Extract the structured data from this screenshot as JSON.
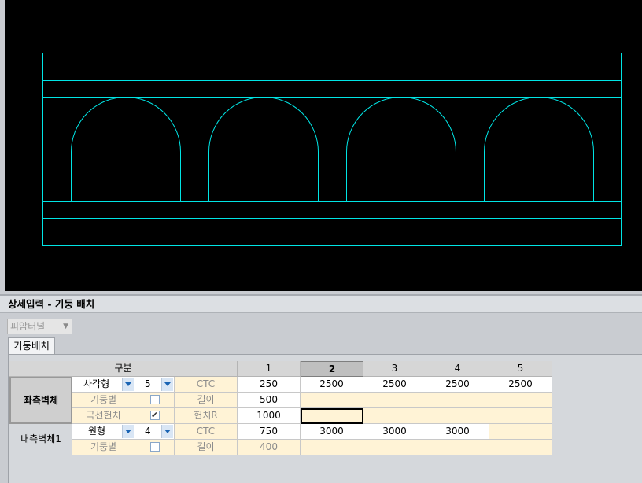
{
  "panel": {
    "title": "상세입력 - 기둥 배치",
    "pattern_select_placeholder": "피암터널",
    "tab_label": "기둥배치"
  },
  "colors": {
    "viewport_bg": "#000000",
    "drawing_line": "#00e5e5",
    "header_selected": "#bfbfbf",
    "yellow_cell": "#fff3d6"
  },
  "grid": {
    "header_label": "구분",
    "column_headers": [
      "1",
      "2",
      "3",
      "4",
      "5"
    ],
    "selected_column": "2",
    "left_wall": {
      "label": "좌측벽체",
      "shape_value": "사각형",
      "count_value": "5",
      "per_column_label": "기둥별",
      "per_column_checked": false,
      "curve_label": "곡선헌치",
      "curve_checked": true,
      "ctc_label": "CTC",
      "length_label": "길이",
      "haunch_label": "헌치R",
      "ctc_values": [
        "250",
        "2500",
        "2500",
        "2500",
        "2500"
      ],
      "length_values": [
        "500",
        "",
        "",
        "",
        ""
      ],
      "haunch_values": [
        "1000",
        "",
        "",
        "",
        ""
      ]
    },
    "inner_wall": {
      "label": "내측벽체1",
      "shape_value": "원형",
      "count_value": "4",
      "per_column_label": "기둥별",
      "per_column_checked": false,
      "ctc_label": "CTC",
      "length_label": "길이",
      "ctc_values": [
        "750",
        "3000",
        "3000",
        "3000",
        ""
      ],
      "length_values": [
        "400",
        "",
        "",
        "",
        ""
      ]
    }
  },
  "drawing": {
    "arch_count": 4
  }
}
